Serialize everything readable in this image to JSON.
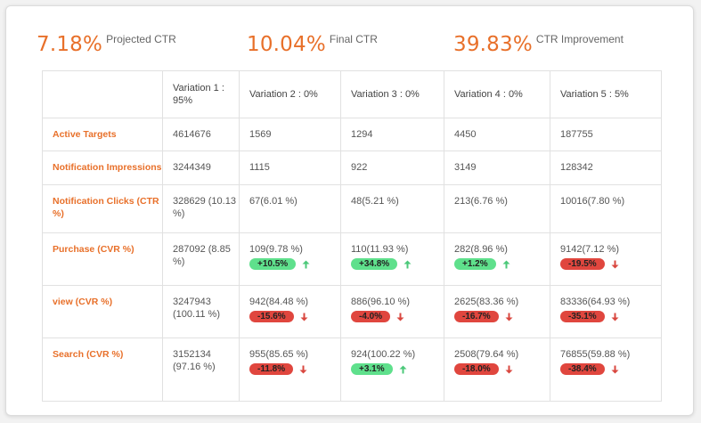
{
  "metrics": [
    {
      "value": "7.18%",
      "label": "Projected CTR"
    },
    {
      "value": "10.04%",
      "label": "Final CTR"
    },
    {
      "value": "39.83%",
      "label": "CTR Improvement"
    }
  ],
  "table": {
    "headers": [
      "",
      "Variation 1 : 95%",
      "Variation 2 : 0%",
      "Variation 3 : 0%",
      "Variation 4 : 0%",
      "Variation 5 : 5%"
    ],
    "rows": [
      {
        "label": "Active Targets",
        "cells": [
          {
            "text": "4614676"
          },
          {
            "text": "1569"
          },
          {
            "text": "1294"
          },
          {
            "text": "4450"
          },
          {
            "text": "187755"
          }
        ]
      },
      {
        "label": "Notification Impressions",
        "cells": [
          {
            "text": "3244349"
          },
          {
            "text": "1115"
          },
          {
            "text": "922"
          },
          {
            "text": "3149"
          },
          {
            "text": "128342"
          }
        ]
      },
      {
        "label": "Notification Clicks (CTR %)",
        "cells": [
          {
            "text": "328629 (10.13 %)"
          },
          {
            "text": "67(6.01 %)"
          },
          {
            "text": "48(5.21 %)"
          },
          {
            "text": "213(6.76 %)"
          },
          {
            "text": "10016(7.80 %)"
          }
        ]
      },
      {
        "label": "Purchase (CVR %)",
        "cells": [
          {
            "text": "287092 (8.85 %)"
          },
          {
            "text": "109(9.78 %)",
            "change": "+10.5%",
            "dir": "up"
          },
          {
            "text": "110(11.93 %)",
            "change": "+34.8%",
            "dir": "up"
          },
          {
            "text": "282(8.96 %)",
            "change": "+1.2%",
            "dir": "up"
          },
          {
            "text": "9142(7.12 %)",
            "change": "-19.5%",
            "dir": "down"
          }
        ]
      },
      {
        "label": "view (CVR %)",
        "cells": [
          {
            "text": "3247943 (100.11 %)"
          },
          {
            "text": "942(84.48 %)",
            "change": "-15.6%",
            "dir": "down"
          },
          {
            "text": "886(96.10 %)",
            "change": "-4.0%",
            "dir": "down"
          },
          {
            "text": "2625(83.36 %)",
            "change": "-16.7%",
            "dir": "down"
          },
          {
            "text": "83336(64.93 %)",
            "change": "-35.1%",
            "dir": "down"
          }
        ]
      },
      {
        "label": "Search (CVR %)",
        "cells": [
          {
            "text": "3152134 (97.16 %)"
          },
          {
            "text": "955(85.65 %)",
            "change": "-11.8%",
            "dir": "down"
          },
          {
            "text": "924(100.22 %)",
            "change": "+3.1%",
            "dir": "up"
          },
          {
            "text": "2508(79.64 %)",
            "change": "-18.0%",
            "dir": "down"
          },
          {
            "text": "76855(59.88 %)",
            "change": "-38.4%",
            "dir": "down"
          }
        ]
      }
    ]
  },
  "colors": {
    "accent": "#e8702a",
    "up": "#5fe08c",
    "down": "#e0463e",
    "upArrow": "#4cc97a",
    "downArrow": "#d9473f"
  },
  "icons": {
    "up": "arrow-up-icon",
    "down": "arrow-down-icon"
  }
}
